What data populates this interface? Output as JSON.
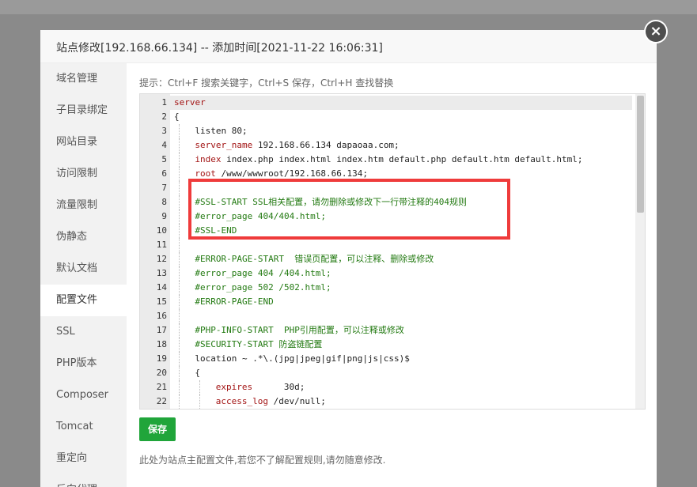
{
  "dialog": {
    "title": "站点修改[192.168.66.134] -- 添加时间[2021-11-22 16:06:31]",
    "close_icon": "close-icon"
  },
  "sidebar": {
    "items": [
      {
        "label": "域名管理"
      },
      {
        "label": "子目录绑定"
      },
      {
        "label": "网站目录"
      },
      {
        "label": "访问限制"
      },
      {
        "label": "流量限制"
      },
      {
        "label": "伪静态"
      },
      {
        "label": "默认文档"
      },
      {
        "label": "配置文件",
        "active": true
      },
      {
        "label": "SSL"
      },
      {
        "label": "PHP版本"
      },
      {
        "label": "Composer"
      },
      {
        "label": "Tomcat"
      },
      {
        "label": "重定向"
      },
      {
        "label": "反向代理"
      }
    ]
  },
  "hint": "提示：Ctrl+F 搜索关键字，Ctrl+S 保存，Ctrl+H 查找替换",
  "editor": {
    "lines": [
      {
        "n": "1",
        "indent": 0,
        "segs": [
          {
            "t": "server",
            "c": "kw"
          }
        ]
      },
      {
        "n": "2",
        "indent": 0,
        "segs": [
          {
            "t": "{",
            "c": "p"
          }
        ]
      },
      {
        "n": "3",
        "indent": 1,
        "segs": [
          {
            "t": "listen 80;",
            "c": "p"
          }
        ]
      },
      {
        "n": "4",
        "indent": 1,
        "segs": [
          {
            "t": "server_name",
            "c": "kw"
          },
          {
            "t": " 192.168.66.134 dapaoaa.com;",
            "c": "p"
          }
        ]
      },
      {
        "n": "5",
        "indent": 1,
        "segs": [
          {
            "t": "index",
            "c": "kw"
          },
          {
            "t": " index.php index.html index.htm default.php default.htm default.html;",
            "c": "p"
          }
        ]
      },
      {
        "n": "6",
        "indent": 1,
        "segs": [
          {
            "t": "root",
            "c": "kw"
          },
          {
            "t": " /www/wwwroot/192.168.66.134;",
            "c": "p"
          }
        ]
      },
      {
        "n": "7",
        "indent": 1,
        "segs": []
      },
      {
        "n": "8",
        "indent": 1,
        "segs": [
          {
            "t": "#SSL-START SSL相关配置，请勿删除或修改下一行带注释的404规则",
            "c": "cm"
          }
        ]
      },
      {
        "n": "9",
        "indent": 1,
        "segs": [
          {
            "t": "#error_page 404/404.html;",
            "c": "cm"
          }
        ]
      },
      {
        "n": "10",
        "indent": 1,
        "segs": [
          {
            "t": "#SSL-END",
            "c": "cm"
          }
        ]
      },
      {
        "n": "11",
        "indent": 1,
        "segs": []
      },
      {
        "n": "12",
        "indent": 1,
        "segs": [
          {
            "t": "#ERROR-PAGE-START  错误页配置，可以注释、删除或修改",
            "c": "cm"
          }
        ]
      },
      {
        "n": "13",
        "indent": 1,
        "segs": [
          {
            "t": "#error_page 404 /404.html;",
            "c": "cm"
          }
        ]
      },
      {
        "n": "14",
        "indent": 1,
        "segs": [
          {
            "t": "#error_page 502 /502.html;",
            "c": "cm"
          }
        ]
      },
      {
        "n": "15",
        "indent": 1,
        "segs": [
          {
            "t": "#ERROR-PAGE-END",
            "c": "cm"
          }
        ]
      },
      {
        "n": "16",
        "indent": 1,
        "segs": []
      },
      {
        "n": "17",
        "indent": 1,
        "segs": [
          {
            "t": "#PHP-INFO-START  PHP引用配置，可以注释或修改",
            "c": "cm"
          }
        ]
      },
      {
        "n": "18",
        "indent": 1,
        "segs": [
          {
            "t": "#SECURITY-START 防盗链配置",
            "c": "cm"
          }
        ]
      },
      {
        "n": "19",
        "indent": 1,
        "segs": [
          {
            "t": "location ~ .*\\.(jpg|jpeg|gif|png|js|css)$",
            "c": "p"
          }
        ]
      },
      {
        "n": "20",
        "indent": 1,
        "segs": [
          {
            "t": "{",
            "c": "p"
          }
        ]
      },
      {
        "n": "21",
        "indent": 2,
        "segs": [
          {
            "t": "expires",
            "c": "kw"
          },
          {
            "t": "      30d;",
            "c": "p"
          }
        ]
      },
      {
        "n": "22",
        "indent": 2,
        "segs": [
          {
            "t": "access_log",
            "c": "kw"
          },
          {
            "t": " /dev/null;",
            "c": "p"
          }
        ]
      }
    ],
    "colors": {
      "kw": "#a31515",
      "p": "#222222",
      "cm": "#237a12"
    }
  },
  "save_label": "保存",
  "note": "此处为站点主配置文件,若您不了解配置规则,请勿随意修改.",
  "colors": {
    "accent": "#20a53a",
    "highlight": "#ef3b3b"
  }
}
